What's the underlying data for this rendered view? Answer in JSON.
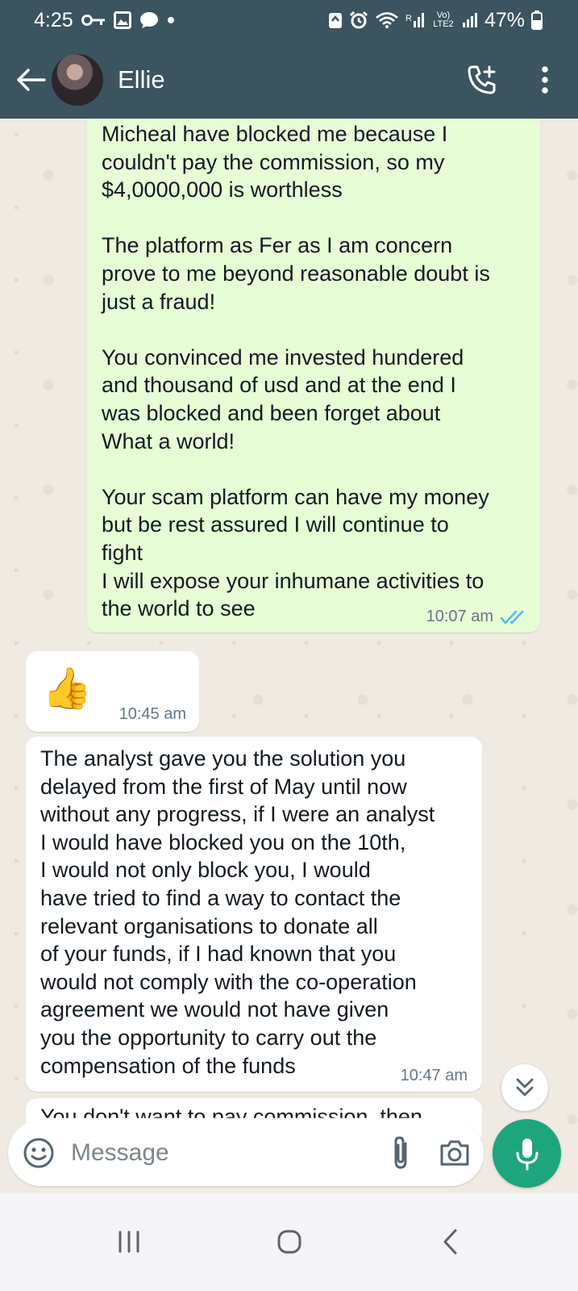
{
  "status_bar": {
    "time": "4:25",
    "battery": "47%",
    "network_label": "Vo) LTE2"
  },
  "header": {
    "contact_name": "Ellie"
  },
  "messages": [
    {
      "direction": "outgoing",
      "text": "Micheal have blocked me because I\ncouldn't pay the commission, so my\n$4,0000,000 is worthless\n\nThe platform as Fer as I am concern\nprove to me beyond reasonable doubt is\njust a fraud!\n\nYou convinced me invested hundered\nand thousand of usd and at the end I\nwas blocked and been forget about\nWhat a world!\n\nYour scam platform can have my money\nbut be rest assured I will continue to\nfight\nI will expose your inhumane activities to\nthe world to see",
      "time": "10:07 am",
      "status": "read"
    },
    {
      "direction": "incoming",
      "emoji": "👍",
      "time": "10:45 am"
    },
    {
      "direction": "incoming",
      "text": "The analyst gave you the solution you\ndelayed from the first of May until now\nwithout any progress, if I were an analyst\nI would have blocked you on the 10th,\nI would not only block you, I would\nhave tried to find a way to contact the\nrelevant organisations to donate all\nof your funds, if I had known that you\nwould not comply with the co-operation\nagreement we would not have given\nyou the opportunity to carry out the\ncompensation of the funds",
      "time": "10:47 am"
    },
    {
      "direction": "incoming",
      "text": "You don't want to pay commission, then"
    }
  ],
  "composer": {
    "placeholder": "Message"
  },
  "colors": {
    "header": "#3b545f",
    "outgoing_bubble": "#e7fdd5",
    "incoming_bubble": "#ffffff",
    "mic_button": "#1da57e",
    "read_ticks": "#53bdeb"
  },
  "icons": {
    "back": "arrow-left-icon",
    "call": "add-call-icon",
    "menu": "more-vert-icon",
    "emoji": "smiley-icon",
    "attach": "paperclip-icon",
    "camera": "camera-icon",
    "mic": "microphone-icon",
    "scroll": "double-chevron-down-icon"
  }
}
